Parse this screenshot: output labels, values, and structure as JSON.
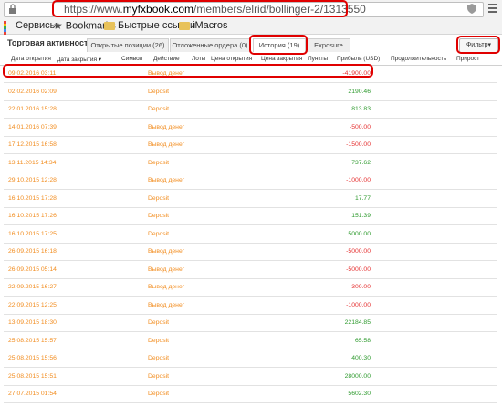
{
  "browser": {
    "url_prefix": "https://www.",
    "url_domain": "myfxbook.com",
    "url_path": "/members/elrid/bollinger-2/1313550"
  },
  "bookmarks": [
    {
      "label": "Сервисы",
      "icon": "apps-icon"
    },
    {
      "label": "Bookmarks",
      "icon": "star-icon"
    },
    {
      "label": "Быстрые ссылки",
      "icon": "folder-icon"
    },
    {
      "label": "iMacros",
      "icon": "folder-icon"
    }
  ],
  "tabs": {
    "section_title": "Торговая активность",
    "items": [
      {
        "label": "Открытые позиции (26)"
      },
      {
        "label": "Отложенные ордера (0)"
      },
      {
        "label": "История (19)"
      },
      {
        "label": "Exposure"
      }
    ],
    "filter_label": "Фильтр"
  },
  "table": {
    "columns": [
      "Дата открытия",
      "Дата закрытия ▾",
      "Символ",
      "Действие",
      "Лоты",
      "Цена открытия",
      "Цена закрытия",
      "Пункты",
      "Прибыль (USD)",
      "Продолжительность",
      "Прирост"
    ],
    "rows": [
      {
        "date": "09.02.2016 03:11",
        "action": "Вывод денег",
        "profit": "-41900.00",
        "sign": "neg"
      },
      {
        "date": "02.02.2016 02:09",
        "action": "Deposit",
        "profit": "2190.46",
        "sign": "pos"
      },
      {
        "date": "22.01.2016 15:28",
        "action": "Deposit",
        "profit": "813.83",
        "sign": "pos"
      },
      {
        "date": "14.01.2016 07:39",
        "action": "Вывод денег",
        "profit": "-500.00",
        "sign": "neg"
      },
      {
        "date": "17.12.2015 16:58",
        "action": "Вывод денег",
        "profit": "-1500.00",
        "sign": "neg"
      },
      {
        "date": "13.11.2015 14:34",
        "action": "Deposit",
        "profit": "737.62",
        "sign": "pos"
      },
      {
        "date": "29.10.2015 12:28",
        "action": "Вывод денег",
        "profit": "-1000.00",
        "sign": "neg"
      },
      {
        "date": "16.10.2015 17:28",
        "action": "Deposit",
        "profit": "17.77",
        "sign": "pos"
      },
      {
        "date": "16.10.2015 17:26",
        "action": "Deposit",
        "profit": "151.39",
        "sign": "pos"
      },
      {
        "date": "16.10.2015 17:25",
        "action": "Deposit",
        "profit": "5000.00",
        "sign": "pos"
      },
      {
        "date": "26.09.2015 16:18",
        "action": "Вывод денег",
        "profit": "-5000.00",
        "sign": "neg"
      },
      {
        "date": "26.09.2015 05:14",
        "action": "Вывод денег",
        "profit": "-5000.00",
        "sign": "neg"
      },
      {
        "date": "22.09.2015 16:27",
        "action": "Вывод денег",
        "profit": "-300.00",
        "sign": "neg"
      },
      {
        "date": "22.09.2015 12:25",
        "action": "Вывод денег",
        "profit": "-1000.00",
        "sign": "neg"
      },
      {
        "date": "13.09.2015 18:30",
        "action": "Deposit",
        "profit": "22184.85",
        "sign": "pos"
      },
      {
        "date": "25.08.2015 15:57",
        "action": "Deposit",
        "profit": "65.58",
        "sign": "pos"
      },
      {
        "date": "25.08.2015 15:56",
        "action": "Deposit",
        "profit": "400.30",
        "sign": "pos"
      },
      {
        "date": "25.08.2015 15:51",
        "action": "Deposit",
        "profit": "28000.00",
        "sign": "pos"
      },
      {
        "date": "27.07.2015 01:54",
        "action": "Deposit",
        "profit": "5602.30",
        "sign": "pos"
      }
    ]
  },
  "colors": {
    "highlight": "#e00000",
    "positive": "#2e9a2e",
    "negative": "#e53030",
    "date_link": "#f28c1e"
  }
}
